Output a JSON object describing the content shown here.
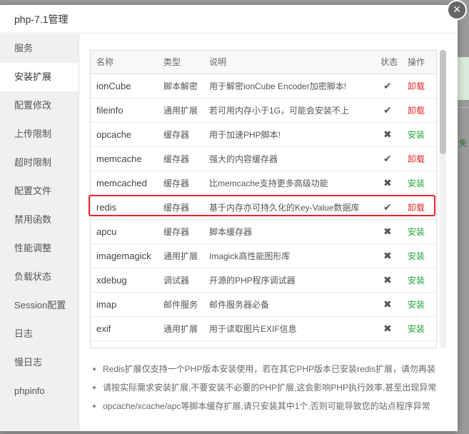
{
  "dialog": {
    "title": "php-7.1管理",
    "close_label": "×"
  },
  "sidebar": {
    "items": [
      {
        "label": "服务"
      },
      {
        "label": "安装扩展",
        "active": true
      },
      {
        "label": "配置修改"
      },
      {
        "label": "上传限制"
      },
      {
        "label": "超时限制"
      },
      {
        "label": "配置文件"
      },
      {
        "label": "禁用函数"
      },
      {
        "label": "性能调整"
      },
      {
        "label": "负载状态"
      },
      {
        "label": "Session配置"
      },
      {
        "label": "日志"
      },
      {
        "label": "慢日志"
      },
      {
        "label": "phpinfo"
      }
    ]
  },
  "table": {
    "headers": {
      "name": "名称",
      "type": "类型",
      "desc": "说明",
      "status": "状态",
      "op": "操作"
    },
    "rows": [
      {
        "name": "ionCube",
        "type": "脚本解密",
        "desc": "用于解密ionCube Encoder加密脚本!",
        "status": "✔",
        "op": "卸载",
        "installed": true
      },
      {
        "name": "fileinfo",
        "type": "通用扩展",
        "desc": "若可用内存小于1G，可能会安装不上",
        "status": "✔",
        "op": "卸载",
        "installed": true
      },
      {
        "name": "opcache",
        "type": "缓存器",
        "desc": "用于加速PHP脚本!",
        "status": "✖",
        "op": "安装",
        "installed": false
      },
      {
        "name": "memcache",
        "type": "缓存器",
        "desc": "强大的内容缓存器",
        "status": "✔",
        "op": "卸载",
        "installed": true
      },
      {
        "name": "memcached",
        "type": "缓存器",
        "desc": "比memcache支持更多高级功能",
        "status": "✖",
        "op": "安装",
        "installed": false
      },
      {
        "name": "redis",
        "type": "缓存器",
        "desc": "基于内存亦可持久化的Key-Value数据库",
        "status": "✔",
        "op": "卸载",
        "installed": true
      },
      {
        "name": "apcu",
        "type": "缓存器",
        "desc": "脚本缓存器",
        "status": "✖",
        "op": "安装",
        "installed": false
      },
      {
        "name": "imagemagick",
        "type": "通用扩展",
        "desc": "Imagick高性能图形库",
        "status": "✖",
        "op": "安装",
        "installed": false
      },
      {
        "name": "xdebug",
        "type": "调试器",
        "desc": "开源的PHP程序调试器",
        "status": "✖",
        "op": "安装",
        "installed": false
      },
      {
        "name": "imap",
        "type": "邮件服务",
        "desc": "邮件服务器必备",
        "status": "✖",
        "op": "安装",
        "installed": false
      },
      {
        "name": "exif",
        "type": "通用扩展",
        "desc": "用于读取图片EXIF信息",
        "status": "✖",
        "op": "安装",
        "installed": false
      }
    ]
  },
  "tips": [
    "Redis扩展仅支持一个PHP版本安装使用，若在其它PHP版本已安装redis扩展，请勿再装",
    "请按实际需求安装扩展,不要安装不必要的PHP扩展,这会影响PHP执行效率,甚至出现异常",
    "opcache/xcache/apc等脚本缓存扩展,请只安装其中1个,否则可能导致您的站点程序异常"
  ],
  "background": {
    "side_text": "免"
  },
  "colors": {
    "uninstall": "#e0282b",
    "install": "#20a53a",
    "highlight": "#e8232a"
  }
}
